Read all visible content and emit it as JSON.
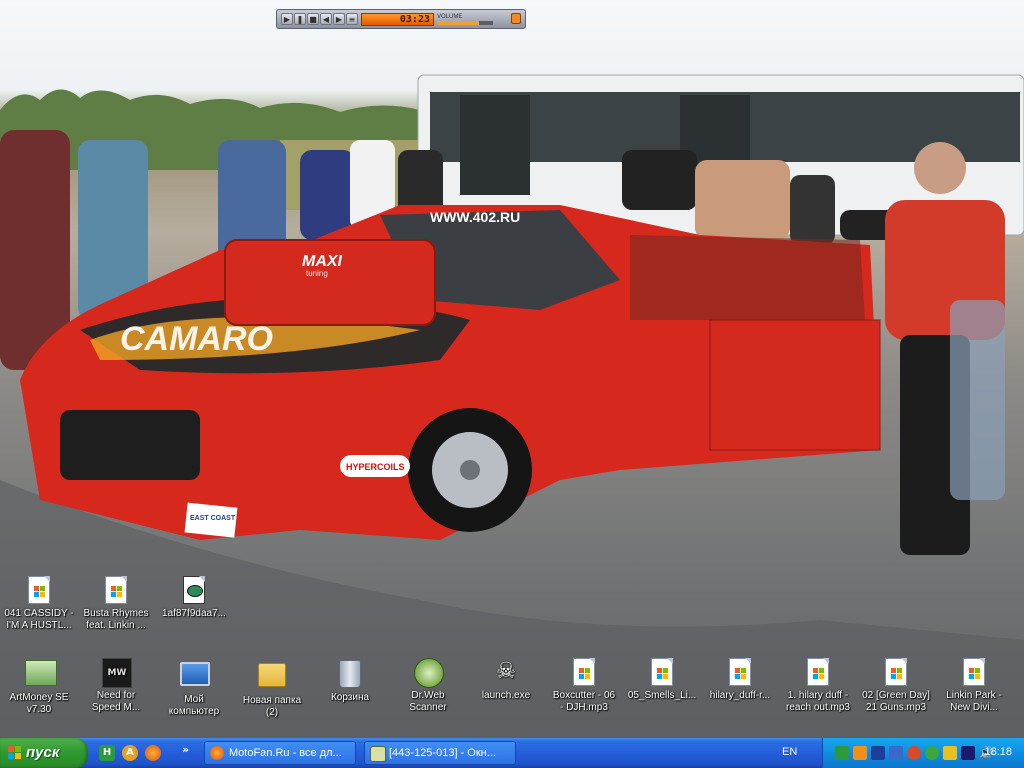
{
  "media_player": {
    "time": "03:23",
    "volume_label": "VOLUME",
    "volume_level": 0.75,
    "buttons": [
      "play",
      "pause",
      "stop",
      "previous",
      "next",
      "playlist"
    ]
  },
  "wallpaper": {
    "website_banner": "WWW.402.RU",
    "hood_text": "CAMARO",
    "scoop_brand": "MAXI",
    "scoop_sub": "tuning",
    "badge_hypercoils": "HYPERCOILS",
    "badge_eastcoast": "EAST COAST"
  },
  "desktop_icons": [
    {
      "id": "cassidy",
      "icon": "wmp-audio-file-icon",
      "label": "041 CASSIDY -\nI'M A HUSTL..."
    },
    {
      "id": "busta",
      "icon": "wmp-audio-file-icon",
      "label": "Busta Rhymes\nfeat. Linkin ..."
    },
    {
      "id": "exe1af",
      "icon": "exe-file-icon",
      "label": "1af87f9daa7..."
    },
    {
      "id": "artmoney",
      "icon": "artmoney-icon",
      "label": "ArtMoney SE\nv7.30"
    },
    {
      "id": "nfsmw",
      "icon": "nfs-most-wanted-icon",
      "label": "Need for\nSpeed M..."
    },
    {
      "id": "mycomputer",
      "icon": "my-computer-icon",
      "label": "Мой\nкомпьютер"
    },
    {
      "id": "newfolder",
      "icon": "folder-icon",
      "label": "Новая папка\n(2)"
    },
    {
      "id": "recyclebin",
      "icon": "recycle-bin-icon",
      "label": "Корзина"
    },
    {
      "id": "drweb",
      "icon": "drweb-scanner-icon",
      "label": "Dr.Web\nScanner"
    },
    {
      "id": "launch",
      "icon": "launch-exe-icon",
      "label": "launch.exe"
    },
    {
      "id": "boxcutter",
      "icon": "wmp-audio-file-icon",
      "label": "Boxcutter - 06\n- DJH.mp3"
    },
    {
      "id": "smells",
      "icon": "wmp-audio-file-icon",
      "label": "05_Smells_Li..."
    },
    {
      "id": "hilary1",
      "icon": "wmp-audio-file-icon",
      "label": "hilary_duff-r..."
    },
    {
      "id": "hilary2",
      "icon": "wmp-audio-file-icon",
      "label": "1. hilary duff -\nreach out.mp3"
    },
    {
      "id": "greenday",
      "icon": "wmp-audio-file-icon",
      "label": "02 [Green Day]\n21 Guns.mp3"
    },
    {
      "id": "linkin",
      "icon": "wmp-audio-file-icon",
      "label": "Linkin Park -\nNew Divi..."
    }
  ],
  "taskbar": {
    "start_label": "пуск",
    "quick_launch": [
      "show-desktop-icon",
      "aimp-icon",
      "firefox-icon"
    ],
    "quick_launch_more": "»",
    "tasks": [
      {
        "label": "MotoFan.Ru - все дл...",
        "icon": "firefox-icon"
      },
      {
        "label": "[443-125-013] - Окн...",
        "icon": "window-icon"
      }
    ],
    "language": "EN",
    "tray_icons": [
      "aimp-tray-icon",
      "media-tray-icon",
      "network-tray-icon",
      "network2-tray-icon",
      "shield-tray-icon",
      "drweb-tray-icon",
      "sync-tray-icon",
      "agent-tray-icon",
      "volume-icon"
    ],
    "clock": "18:18"
  },
  "colors": {
    "taskbar_blue": "#245edb",
    "start_green": "#2f9a2f",
    "tray_blue": "#0f8de0",
    "player_time_orange": "#f07a10"
  }
}
